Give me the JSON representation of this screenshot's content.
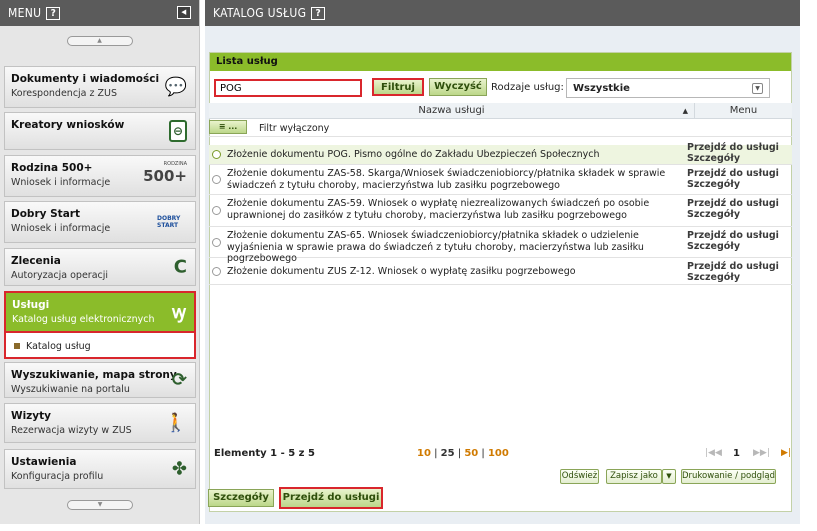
{
  "sidebar": {
    "title": "MENU",
    "help": "?",
    "items": [
      {
        "title": "Dokumenty i wiadomości",
        "subtitle": "Korespondencja z ZUS",
        "icon": "speech-bubble-icon"
      },
      {
        "title": "Kreatory wniosków",
        "subtitle": "",
        "icon": "document-wizard-icon"
      },
      {
        "title": "Rodzina 500+",
        "subtitle": "Wniosek i informacje",
        "icon": "rodzina-500-logo",
        "logo_text": "500+",
        "logo_small": "RODZINA"
      },
      {
        "title": "Dobry Start",
        "subtitle": "Wniosek i informacje",
        "icon": "dobry-start-logo",
        "logo_text": "DOBRY START"
      },
      {
        "title": "Zlecenia",
        "subtitle": "Autoryzacja operacji",
        "icon": "refresh-arrow-icon"
      },
      {
        "title": "Usługi",
        "subtitle": "Katalog usług elektronicznych",
        "icon": "services-icon"
      },
      {
        "title": "Wyszukiwanie, mapa strony",
        "subtitle": "Wyszukiwanie na portalu",
        "icon": "sync-icon"
      },
      {
        "title": "Wizyty",
        "subtitle": "Rezerwacja wizyty w ZUS",
        "icon": "walking-person-icon"
      },
      {
        "title": "Ustawienia",
        "subtitle": "Konfiguracja profilu",
        "icon": "puzzle-icon"
      }
    ],
    "subitem": "Katalog usług"
  },
  "main": {
    "title": "KATALOG USŁUG",
    "help": "?",
    "panel_title": "Lista usług",
    "search_value": "POG",
    "filter_button": "Filtruj",
    "clear_button": "Wyczyść",
    "type_label": "Rodzaje usług:",
    "type_value": "Wszystkie",
    "col_name": "Nazwa usługi",
    "col_menu": "Menu",
    "filter_status": "Filtr wyłączony",
    "filter_toggle": "...",
    "rows": [
      {
        "name": "Złożenie dokumentu POG. Pismo ogólne do Zakładu Ubezpieczeń Społecznych",
        "menu1": "Przejdź do usługi",
        "menu2": "Szczegóły"
      },
      {
        "name": "Złożenie dokumentu ZAS-58. Skarga/Wniosek świadczeniobiorcy/płatnika składek w sprawie świadczeń z tytułu choroby, macierzyństwa lub zasiłku pogrzebowego",
        "menu1": "Przejdź do usługi",
        "menu2": "Szczegóły"
      },
      {
        "name": "Złożenie dokumentu ZAS-59. Wniosek o wypłatę niezrealizowanych świadczeń po osobie uprawnionej do zasiłków z tytułu choroby, macierzyństwa lub zasiłku pogrzebowego",
        "menu1": "Przejdź do usługi",
        "menu2": "Szczegóły"
      },
      {
        "name": "Złożenie dokumentu ZAS-65. Wniosek świadczeniobiorcy/płatnika składek o udzielenie wyjaśnienia w sprawie prawa do świadczeń z tytułu choroby, macierzyństwa lub zasiłku pogrzebowego",
        "menu1": "Przejdź do usługi",
        "menu2": "Szczegóły"
      },
      {
        "name": "Złożenie dokumentu ZUS Z-12. Wniosek o wypłatę zasiłku pogrzebowego",
        "menu1": "Przejdź do usługi",
        "menu2": "Szczegóły"
      }
    ],
    "pager": {
      "info": "Elementy 1 - 5 z 5",
      "size_10": "10",
      "size_25": "25",
      "size_50": "50",
      "size_100": "100",
      "page": "1"
    },
    "refresh": "Odśwież",
    "save_as": "Zapisz jako",
    "print": "Drukowanie / podgląd",
    "details_button": "Szczegóły",
    "goto_button": "Przejdź do usługi"
  }
}
